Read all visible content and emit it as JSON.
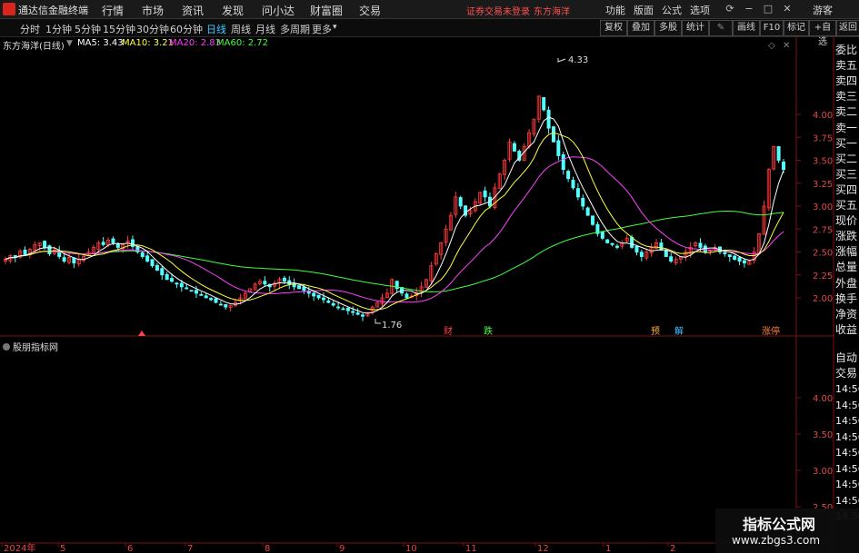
{
  "app": {
    "title": "通达信金融终端",
    "status": "证券交易未登录",
    "stock_name": "东方海洋"
  },
  "menu": [
    "行情",
    "市场",
    "资讯",
    "发现",
    "问小达",
    "财富圈",
    "交易"
  ],
  "right_menu": [
    "功能",
    "版面",
    "公式",
    "选项"
  ],
  "guest": "游客",
  "period_tabs": [
    "分时",
    "1分钟",
    "5分钟",
    "15分钟",
    "30分钟",
    "60分钟",
    "日线",
    "周线",
    "月线",
    "多周期",
    "更多"
  ],
  "active_period": "日线",
  "toolbar_buttons": [
    "复权",
    "叠加",
    "多股",
    "统计",
    "画线",
    "F10",
    "标记",
    "+自选",
    "返回"
  ],
  "legend": {
    "title": "东方海洋(日线)",
    "ma5": "MA5: 3.43",
    "ma10": "MA10: 3.21",
    "ma20": "MA20: 2.83",
    "ma60": "MA60: 2.72",
    "colors": {
      "ma5": "#ffffff",
      "ma10": "#ffff40",
      "ma20": "#ff40ff",
      "ma60": "#40ff40"
    }
  },
  "sub_indicator": "股朋指标网",
  "side_panel": [
    "委比",
    "卖五",
    "卖四",
    "卖三",
    "卖二",
    "卖一",
    "买一",
    "买二",
    "买三",
    "买四",
    "买五",
    "现价",
    "涨跌",
    "涨幅",
    "总量",
    "外盘",
    "换手",
    "净资",
    "收益"
  ],
  "side_panel2": [
    "自动",
    "交易"
  ],
  "side_times": [
    "14:56",
    "14:56",
    "14:56",
    "14:56",
    "14:56",
    "14:56",
    "14:56",
    "14:56",
    "14:56"
  ],
  "watermark": {
    "title": "指标公式网",
    "url": "www.zbgs3.com"
  },
  "chart_data": {
    "type": "candlestick",
    "y_axis_main": [
      "4.00",
      "3.75",
      "3.50",
      "3.25",
      "3.00",
      "2.75",
      "2.50",
      "2.25",
      "2.00"
    ],
    "y_axis_sub": [
      "4.00",
      "3.50",
      "3.00",
      "2.50"
    ],
    "x_labels": [
      "2024年",
      "5",
      "6",
      "7",
      "8",
      "9",
      "10",
      "11",
      "12",
      "1",
      "2"
    ],
    "annotations": {
      "high": "4.33",
      "low": "1.76"
    },
    "event_markers": [
      "财",
      "跌",
      "预",
      "解",
      "涨停"
    ],
    "ylim": [
      1.6,
      4.5
    ],
    "closes": [
      2.42,
      2.46,
      2.44,
      2.51,
      2.47,
      2.53,
      2.58,
      2.6,
      2.55,
      2.48,
      2.52,
      2.45,
      2.4,
      2.44,
      2.38,
      2.42,
      2.45,
      2.5,
      2.55,
      2.6,
      2.58,
      2.63,
      2.6,
      2.55,
      2.58,
      2.62,
      2.56,
      2.5,
      2.45,
      2.4,
      2.35,
      2.3,
      2.25,
      2.2,
      2.18,
      2.15,
      2.12,
      2.1,
      2.08,
      2.05,
      2.03,
      2.0,
      1.98,
      1.95,
      1.93,
      1.9,
      1.92,
      1.95,
      2.0,
      2.05,
      2.1,
      2.15,
      2.18,
      2.15,
      2.12,
      2.16,
      2.2,
      2.18,
      2.15,
      2.12,
      2.1,
      2.08,
      2.05,
      2.02,
      2.0,
      1.98,
      1.95,
      1.92,
      1.9,
      1.88,
      1.86,
      1.84,
      1.82,
      1.8,
      1.84,
      1.9,
      1.95,
      2.0,
      2.05,
      2.2,
      2.1,
      2.05,
      2.0,
      2.02,
      2.06,
      2.12,
      2.2,
      2.35,
      2.48,
      2.6,
      2.75,
      2.9,
      3.1,
      3.0,
      2.9,
      2.95,
      3.05,
      3.15,
      3.1,
      3.0,
      3.2,
      3.35,
      3.5,
      3.7,
      3.6,
      3.5,
      3.65,
      3.8,
      3.95,
      4.2,
      4.05,
      3.85,
      3.7,
      3.55,
      3.4,
      3.3,
      3.2,
      3.1,
      3.0,
      2.9,
      2.8,
      2.7,
      2.65,
      2.6,
      2.58,
      2.55,
      2.6,
      2.65,
      2.55,
      2.5,
      2.45,
      2.5,
      2.55,
      2.6,
      2.52,
      2.45,
      2.4,
      2.42,
      2.45,
      2.5,
      2.55,
      2.6,
      2.55,
      2.5,
      2.52,
      2.55,
      2.5,
      2.48,
      2.45,
      2.42,
      2.4,
      2.38,
      2.4,
      2.5,
      2.7,
      3.0,
      3.4,
      3.65,
      3.5,
      3.4
    ]
  }
}
